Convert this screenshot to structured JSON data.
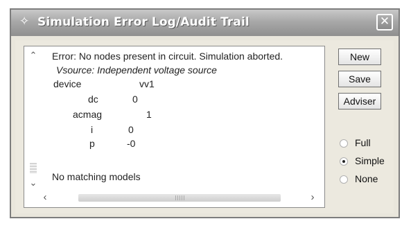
{
  "window": {
    "title": "Simulation Error Log/Audit Trail",
    "title_icon": "sparkle-icon",
    "close_icon": "close-icon"
  },
  "log": {
    "lines": [
      "Error: No nodes present in circuit. Simulation aborted.",
      "Vsource: Independent voltage source",
      "device",
      "vv1",
      "dc",
      "0",
      "acmag",
      "1",
      "i",
      "0",
      "p",
      "-0",
      "No matching models"
    ]
  },
  "buttons": {
    "new": "New",
    "save": "Save",
    "adviser": "Adviser"
  },
  "mode": {
    "options": [
      "Full",
      "Simple",
      "None"
    ],
    "selected": "Simple"
  }
}
